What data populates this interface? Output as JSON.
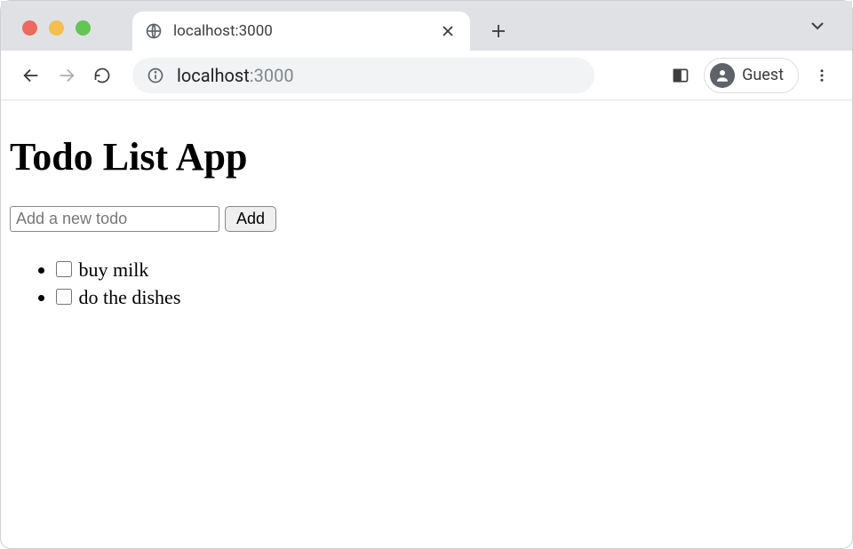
{
  "browser": {
    "tab_title": "localhost:3000",
    "url_host": "localhost",
    "url_port": ":3000",
    "profile_name": "Guest"
  },
  "page": {
    "heading": "Todo List App",
    "input_placeholder": "Add a new todo",
    "add_button_label": "Add",
    "todos": [
      {
        "label": "buy milk",
        "checked": false
      },
      {
        "label": "do the dishes",
        "checked": false
      }
    ]
  }
}
